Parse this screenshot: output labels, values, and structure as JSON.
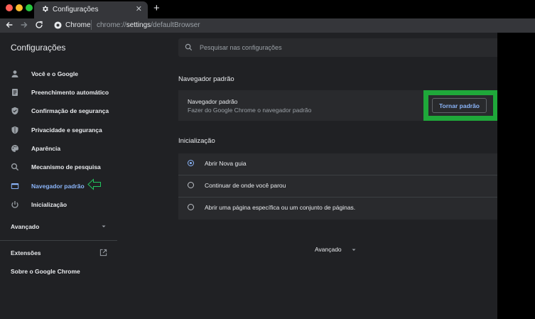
{
  "tab": {
    "title": "Configurações"
  },
  "toolbar": {
    "url_site": "Chrome",
    "url_prefix": "chrome://",
    "url_bold": "settings",
    "url_suffix": "/defaultBrowser"
  },
  "header": {
    "title": "Configurações",
    "search_placeholder": "Pesquisar nas configurações"
  },
  "sidebar": {
    "items": [
      {
        "label": "Você e o Google",
        "icon": "person-icon"
      },
      {
        "label": "Preenchimento automático",
        "icon": "assignment-icon"
      },
      {
        "label": "Confirmação de segurança",
        "icon": "shield-check-icon"
      },
      {
        "label": "Privacidade e segurança",
        "icon": "shield-icon"
      },
      {
        "label": "Aparência",
        "icon": "palette-icon"
      },
      {
        "label": "Mecanismo de pesquisa",
        "icon": "search-icon"
      },
      {
        "label": "Navegador padrão",
        "icon": "browser-icon",
        "active": true
      },
      {
        "label": "Inicialização",
        "icon": "power-icon"
      }
    ],
    "advanced": "Avançado",
    "extensions": "Extensões",
    "about": "Sobre o Google Chrome"
  },
  "main": {
    "default_browser": {
      "section_title": "Navegador padrão",
      "card_title": "Navegador padrão",
      "card_subtitle": "Fazer do Google Chrome o navegador padrão",
      "button": "Tornar padrão"
    },
    "startup": {
      "section_title": "Inicialização",
      "options": [
        {
          "label": "Abrir Nova guia",
          "selected": true
        },
        {
          "label": "Continuar de onde você parou",
          "selected": false
        },
        {
          "label": "Abrir uma página específica ou um conjunto de páginas.",
          "selected": false
        }
      ]
    },
    "advanced": "Avançado"
  },
  "colors": {
    "accent": "#8ab4f8",
    "highlight": "#1fa83a",
    "background": "#202124",
    "card": "#292a2d"
  }
}
